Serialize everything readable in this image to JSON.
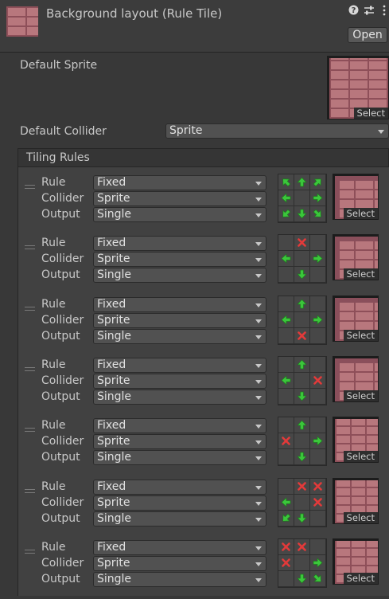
{
  "header": {
    "title": "Background layout (Rule Tile)",
    "help_icon": "help-icon",
    "settings_icon": "preset-sliders-icon",
    "menu_icon": "kebab-menu-icon",
    "open_label": "Open"
  },
  "default_sprite": {
    "label": "Default Sprite",
    "select_label": "Select"
  },
  "default_collider": {
    "label": "Default Collider",
    "value": "Sprite"
  },
  "tiling_rules": {
    "title": "Tiling Rules",
    "field_labels": {
      "rule": "Rule",
      "collider": "Collider",
      "output": "Output"
    },
    "rules": [
      {
        "rule": "Fixed",
        "collider": "Sprite",
        "output": "Single",
        "select_label": "Select",
        "neighbors": [
          "arrow-nw",
          "arrow-n",
          "arrow-ne",
          "arrow-w",
          "center",
          "arrow-e",
          "arrow-sw",
          "arrow-s",
          "arrow-se"
        ]
      },
      {
        "rule": "Fixed",
        "collider": "Sprite",
        "output": "Single",
        "select_label": "Select",
        "neighbors": [
          "empty",
          "not-this",
          "empty",
          "arrow-w",
          "center",
          "arrow-e",
          "empty",
          "arrow-s",
          "empty"
        ]
      },
      {
        "rule": "Fixed",
        "collider": "Sprite",
        "output": "Single",
        "select_label": "Select",
        "neighbors": [
          "empty",
          "arrow-n",
          "empty",
          "arrow-w",
          "center",
          "arrow-e",
          "empty",
          "not-this",
          "empty"
        ]
      },
      {
        "rule": "Fixed",
        "collider": "Sprite",
        "output": "Single",
        "select_label": "Select",
        "neighbors": [
          "empty",
          "arrow-n",
          "empty",
          "arrow-w",
          "center",
          "not-this",
          "empty",
          "arrow-s",
          "empty"
        ]
      },
      {
        "rule": "Fixed",
        "collider": "Sprite",
        "output": "Single",
        "select_label": "Select",
        "neighbors": [
          "empty",
          "arrow-n",
          "empty",
          "not-this",
          "center",
          "arrow-e",
          "empty",
          "arrow-s",
          "empty"
        ]
      },
      {
        "rule": "Fixed",
        "collider": "Sprite",
        "output": "Single",
        "select_label": "Select",
        "neighbors": [
          "empty",
          "not-this",
          "not-this",
          "arrow-w",
          "center",
          "not-this",
          "arrow-sw",
          "arrow-s",
          "empty"
        ]
      },
      {
        "rule": "Fixed",
        "collider": "Sprite",
        "output": "Single",
        "select_label": "Select",
        "neighbors": [
          "not-this",
          "not-this",
          "empty",
          "not-this",
          "center",
          "arrow-e",
          "empty",
          "arrow-s",
          "arrow-se"
        ]
      }
    ]
  },
  "colors": {
    "arrow": "#3bc63b",
    "not_this": "#e23a3a",
    "brick": "#b8777d",
    "mortar": "#8e4f59"
  }
}
